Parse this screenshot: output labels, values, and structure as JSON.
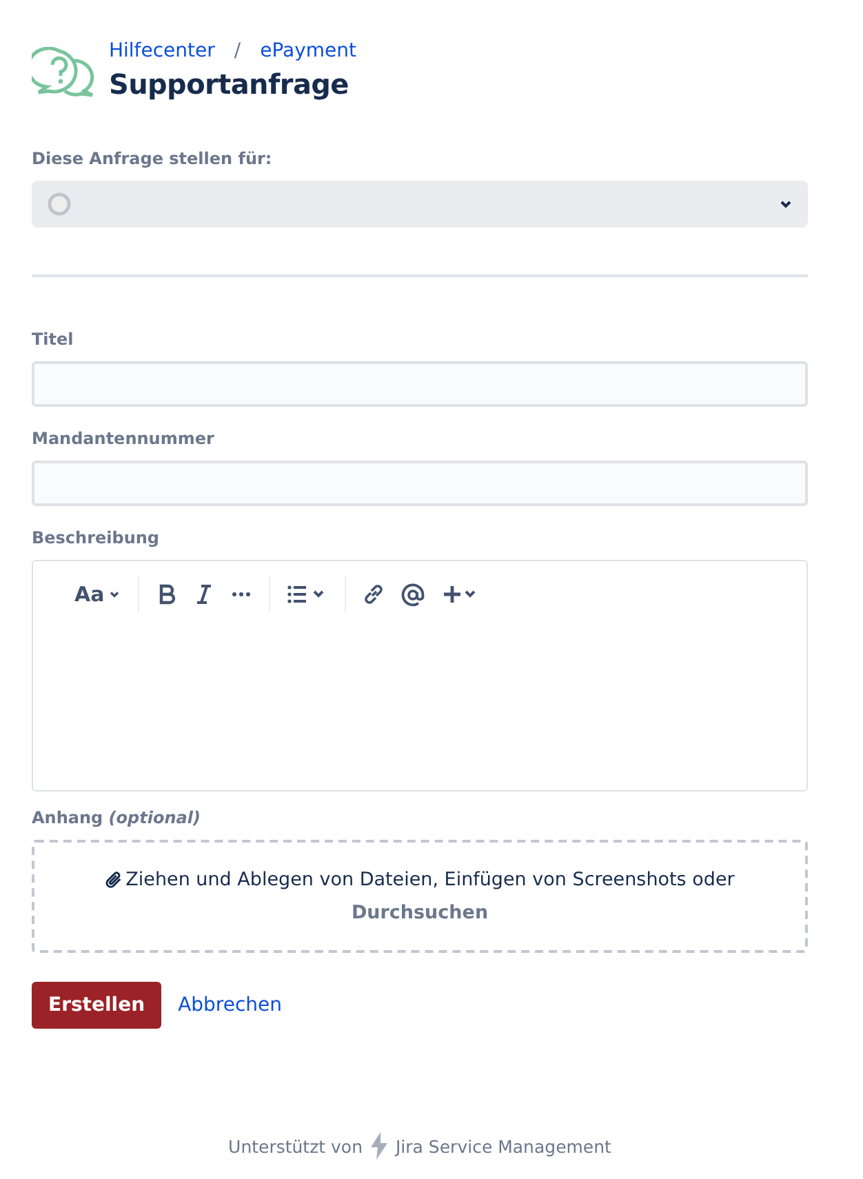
{
  "breadcrumbs": [
    "Hilfecenter",
    "ePayment"
  ],
  "breadcrumb_separator": "/",
  "title": "Supportanfrage",
  "requester": {
    "label": "Diese Anfrage stellen für:"
  },
  "fields": [
    {
      "label": "Titel"
    },
    {
      "label": "Mandantennummer"
    }
  ],
  "description": {
    "label": "Beschreibung",
    "toolbar_text_style": "Aa"
  },
  "attachment": {
    "label": "Anhang *(optional)*",
    "hint": "Ziehen und Ablegen von Dateien, Einfügen von Screenshots oder",
    "browse": "Durchsuchen"
  },
  "buttons": {
    "submit": "Erstellen",
    "cancel": "Abbrechen"
  },
  "footer": {
    "prefix": "Unterstützt von",
    "product": "Jira Service Management"
  }
}
